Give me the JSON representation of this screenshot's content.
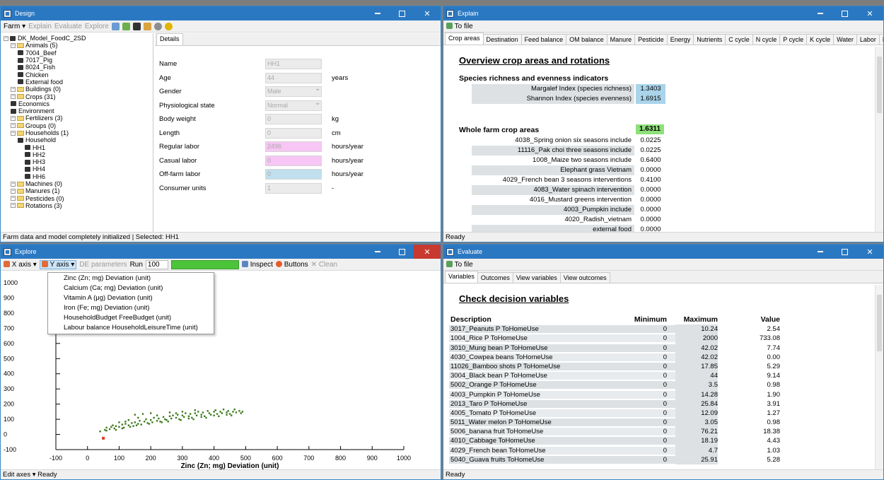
{
  "design": {
    "title": "Design",
    "toolbar": {
      "farm": "Farm",
      "explain": "Explain",
      "evaluate": "Evaluate",
      "explore": "Explore"
    },
    "tab": "Details",
    "tree": [
      {
        "label": "DK_Model_FoodC_2SD",
        "indent": 0,
        "kind": "root"
      },
      {
        "label": "Animals (5)",
        "indent": 1,
        "kind": "folder"
      },
      {
        "label": "7004_Beef",
        "indent": 2,
        "kind": "node"
      },
      {
        "label": "7017_Pig",
        "indent": 2,
        "kind": "node"
      },
      {
        "label": "8024_Fish",
        "indent": 2,
        "kind": "node"
      },
      {
        "label": "Chicken",
        "indent": 2,
        "kind": "node"
      },
      {
        "label": "External food",
        "indent": 2,
        "kind": "node"
      },
      {
        "label": "Buildings (0)",
        "indent": 1,
        "kind": "folder"
      },
      {
        "label": "Crops (31)",
        "indent": 1,
        "kind": "folder"
      },
      {
        "label": "Economics",
        "indent": 1,
        "kind": "node"
      },
      {
        "label": "Environment",
        "indent": 1,
        "kind": "node"
      },
      {
        "label": "Fertilizers (3)",
        "indent": 1,
        "kind": "folder"
      },
      {
        "label": "Groups (0)",
        "indent": 1,
        "kind": "folder"
      },
      {
        "label": "Households (1)",
        "indent": 1,
        "kind": "folder"
      },
      {
        "label": "Household",
        "indent": 2,
        "kind": "node"
      },
      {
        "label": "HH1",
        "indent": 3,
        "kind": "node"
      },
      {
        "label": "HH2",
        "indent": 3,
        "kind": "node"
      },
      {
        "label": "HH3",
        "indent": 3,
        "kind": "node"
      },
      {
        "label": "HH4",
        "indent": 3,
        "kind": "node"
      },
      {
        "label": "HH6",
        "indent": 3,
        "kind": "node"
      },
      {
        "label": "Machines (0)",
        "indent": 1,
        "kind": "folder"
      },
      {
        "label": "Manures (1)",
        "indent": 1,
        "kind": "folder"
      },
      {
        "label": "Pesticides (0)",
        "indent": 1,
        "kind": "folder"
      },
      {
        "label": "Rotations (3)",
        "indent": 1,
        "kind": "folder"
      }
    ],
    "details": [
      {
        "label": "Name",
        "value": "HH1",
        "unit": "",
        "bg": "#ebebeb"
      },
      {
        "label": "Age",
        "value": "44",
        "unit": "years",
        "bg": "#ebebeb"
      },
      {
        "label": "Gender",
        "value": "Male",
        "unit": "",
        "bg": "#ebebeb",
        "select": true
      },
      {
        "label": "Physiological state",
        "value": "Normal",
        "unit": "",
        "bg": "#ebebeb",
        "select": true
      },
      {
        "label": "Body weight",
        "value": "0",
        "unit": "kg",
        "bg": "#ebebeb"
      },
      {
        "label": "Length",
        "value": "0",
        "unit": "cm",
        "bg": "#ebebeb"
      },
      {
        "label": "Regular labor",
        "value": "2496",
        "unit": "hours/year",
        "bg": "#f7c6f4"
      },
      {
        "label": "Casual labor",
        "value": "0",
        "unit": "hours/year",
        "bg": "#f7c6f4"
      },
      {
        "label": "Off-farm labor",
        "value": "0",
        "unit": "hours/year",
        "bg": "#bfe0ec"
      },
      {
        "label": "Consumer units",
        "value": "1",
        "unit": "-",
        "bg": "#ebebeb"
      }
    ],
    "status": "Farm data and model completely initialized  | Selected: HH1"
  },
  "explain": {
    "title": "Explain",
    "tofile": "To file",
    "tabs": [
      "Crop areas",
      "Destination",
      "Feed balance",
      "OM balance",
      "Manure",
      "Pesticide",
      "Energy",
      "Nutrients",
      "C cycle",
      "N cycle",
      "P cycle",
      "K cycle",
      "Water",
      "Labor",
      "Pr"
    ],
    "heading": "Overview crop areas and rotations",
    "species_heading": "Species richness and evenness indicators",
    "indices": [
      {
        "label": "Margalef Index (species richness)",
        "value": "1.3403"
      },
      {
        "label": "Shannon Index (species evenness)",
        "value": "1.6915"
      }
    ],
    "whole_label": "Whole farm crop areas",
    "whole_value": "1.6311",
    "crops": [
      {
        "label": "4038_Spring onion six seasons include",
        "value": "0.0225"
      },
      {
        "label": "11116_Pak choi three seasons include",
        "value": "0.0225"
      },
      {
        "label": "1008_Maize two seasons include",
        "value": "0.6400"
      },
      {
        "label": "Elephant grass Vietnam",
        "value": "0.0000"
      },
      {
        "label": "4029_French bean 3 seasons interventions",
        "value": "0.4100"
      },
      {
        "label": "4083_Water spinach intervention",
        "value": "0.0000"
      },
      {
        "label": "4016_Mustard greens intervention",
        "value": "0.0000"
      },
      {
        "label": "4003_Pumpkin include",
        "value": "0.0000"
      },
      {
        "label": "4020_Radish_vietnam",
        "value": "0.0000"
      },
      {
        "label": "external food",
        "value": "0.0000"
      }
    ],
    "status": "Ready"
  },
  "explore": {
    "title": "Explore",
    "toolbar": {
      "xaxis": "X axis",
      "yaxis": "Y axis",
      "de": "DE parameters",
      "run": "Run",
      "run_value": "100",
      "inspect": "Inspect",
      "buttons": "Buttons",
      "clean": "Clean"
    },
    "menu": [
      "Zinc (Zn; mg) Deviation (unit)",
      "Calcium (Ca; mg) Deviation (unit)",
      "Vitamin A (μg) Deviation (unit)",
      "Iron (Fe; mg) Deviation (unit)",
      "HouseholdBudget FreeBudget (unit)",
      "Labour balance HouseholdLeisureTime (unit)"
    ],
    "status_edit": "Edit axes",
    "status": "Ready"
  },
  "chart_data": {
    "type": "scatter",
    "xlabel": "Zinc (Zn; mg) Deviation (unit)",
    "ylabel": "",
    "xlim": [
      -100,
      1000
    ],
    "ylim": [
      -100,
      1000
    ],
    "x_ticks": [
      "-100",
      "0",
      "100",
      "200",
      "300",
      "400",
      "500",
      "600",
      "700",
      "800",
      "900",
      "1000"
    ],
    "y_ticks": [
      "1000",
      "900",
      "800",
      "700",
      "600",
      "500",
      "400",
      "300",
      "200",
      "100",
      "0",
      "-100"
    ],
    "series_color": "#3d7a1c",
    "highlight_color": "#e53b2c",
    "points": [
      [
        40,
        20
      ],
      [
        55,
        30
      ],
      [
        60,
        45
      ],
      [
        70,
        35
      ],
      [
        75,
        50
      ],
      [
        85,
        40
      ],
      [
        90,
        55
      ],
      [
        100,
        50
      ],
      [
        110,
        65
      ],
      [
        115,
        45
      ],
      [
        120,
        70
      ],
      [
        130,
        60
      ],
      [
        140,
        75
      ],
      [
        145,
        55
      ],
      [
        150,
        80
      ],
      [
        160,
        70
      ],
      [
        165,
        90
      ],
      [
        170,
        65
      ],
      [
        180,
        85
      ],
      [
        185,
        100
      ],
      [
        190,
        75
      ],
      [
        200,
        95
      ],
      [
        205,
        80
      ],
      [
        210,
        110
      ],
      [
        220,
        90
      ],
      [
        225,
        105
      ],
      [
        230,
        85
      ],
      [
        240,
        115
      ],
      [
        245,
        100
      ],
      [
        250,
        95
      ],
      [
        260,
        120
      ],
      [
        265,
        105
      ],
      [
        270,
        125
      ],
      [
        280,
        110
      ],
      [
        285,
        130
      ],
      [
        290,
        100
      ],
      [
        300,
        125
      ],
      [
        305,
        115
      ],
      [
        310,
        140
      ],
      [
        320,
        120
      ],
      [
        325,
        135
      ],
      [
        330,
        110
      ],
      [
        340,
        140
      ],
      [
        345,
        125
      ],
      [
        350,
        150
      ],
      [
        360,
        130
      ],
      [
        365,
        145
      ],
      [
        370,
        120
      ],
      [
        380,
        155
      ],
      [
        385,
        140
      ],
      [
        390,
        130
      ],
      [
        400,
        150
      ],
      [
        405,
        160
      ],
      [
        410,
        135
      ],
      [
        420,
        150
      ],
      [
        425,
        140
      ],
      [
        430,
        165
      ],
      [
        440,
        145
      ],
      [
        445,
        155
      ],
      [
        450,
        135
      ],
      [
        460,
        150
      ],
      [
        465,
        165
      ],
      [
        470,
        145
      ],
      [
        480,
        155
      ],
      [
        485,
        140
      ],
      [
        490,
        150
      ],
      [
        150,
        130
      ],
      [
        175,
        135
      ],
      [
        200,
        140
      ],
      [
        100,
        80
      ],
      [
        130,
        95
      ],
      [
        260,
        145
      ],
      [
        300,
        150
      ],
      [
        340,
        160
      ],
      [
        80,
        60
      ],
      [
        120,
        85
      ],
      [
        160,
        110
      ],
      [
        220,
        125
      ],
      [
        280,
        140
      ],
      [
        320,
        105
      ],
      [
        360,
        115
      ],
      [
        400,
        125
      ],
      [
        440,
        130
      ],
      [
        60,
        25
      ],
      [
        90,
        30
      ],
      [
        110,
        40
      ],
      [
        135,
        50
      ],
      [
        155,
        60
      ],
      [
        195,
        70
      ],
      [
        235,
        80
      ],
      [
        255,
        85
      ],
      [
        295,
        95
      ],
      [
        335,
        100
      ],
      [
        375,
        110
      ],
      [
        415,
        120
      ],
      [
        455,
        125
      ]
    ],
    "highlight_point": [
      50,
      -25
    ]
  },
  "evaluate": {
    "title": "Evaluate",
    "tofile": "To file",
    "tabs": [
      "Variables",
      "Outcomes",
      "View variables",
      "View outcomes"
    ],
    "heading": "Check decision variables",
    "cols": {
      "desc": "Description",
      "min": "Minimum",
      "max": "Maximum",
      "val": "Value"
    },
    "rows": [
      [
        "3017_Peanuts P ToHomeUse",
        "0",
        "10.24",
        "2.54"
      ],
      [
        "1004_Rice P ToHomeUse",
        "0",
        "2000",
        "733.08"
      ],
      [
        "3010_Mung bean P ToHomeUse",
        "0",
        "42.02",
        "7.74"
      ],
      [
        "4030_Cowpea beans ToHomeUse",
        "0",
        "42.02",
        "0.00"
      ],
      [
        "11026_Bamboo shots P ToHomeUse",
        "0",
        "17.85",
        "5.29"
      ],
      [
        "3004_Black bean P ToHomeUse",
        "0",
        "44",
        "9.14"
      ],
      [
        "5002_Orange P ToHomeUse",
        "0",
        "3.5",
        "0.98"
      ],
      [
        "4003_Pumpkin P ToHomeUse",
        "0",
        "14.28",
        "1.90"
      ],
      [
        "2013_Taro P ToHomeUse",
        "0",
        "25.84",
        "3.91"
      ],
      [
        "4005_Tomato P ToHomeUse",
        "0",
        "12.09",
        "1.27"
      ],
      [
        "5011_Water melon P ToHomeUse",
        "0",
        "3.05",
        "0.98"
      ],
      [
        "5006_banana fruit ToHomeUse",
        "0",
        "76.21",
        "18.38"
      ],
      [
        "4010_Cabbage ToHomeUse",
        "0",
        "18.19",
        "4.43"
      ],
      [
        "4029_French bean ToHomeUse",
        "0",
        "4.7",
        "1.03"
      ],
      [
        "5040_Guava fruits ToHomeUse",
        "0",
        "25.91",
        "5.28"
      ]
    ],
    "status": "Ready"
  }
}
